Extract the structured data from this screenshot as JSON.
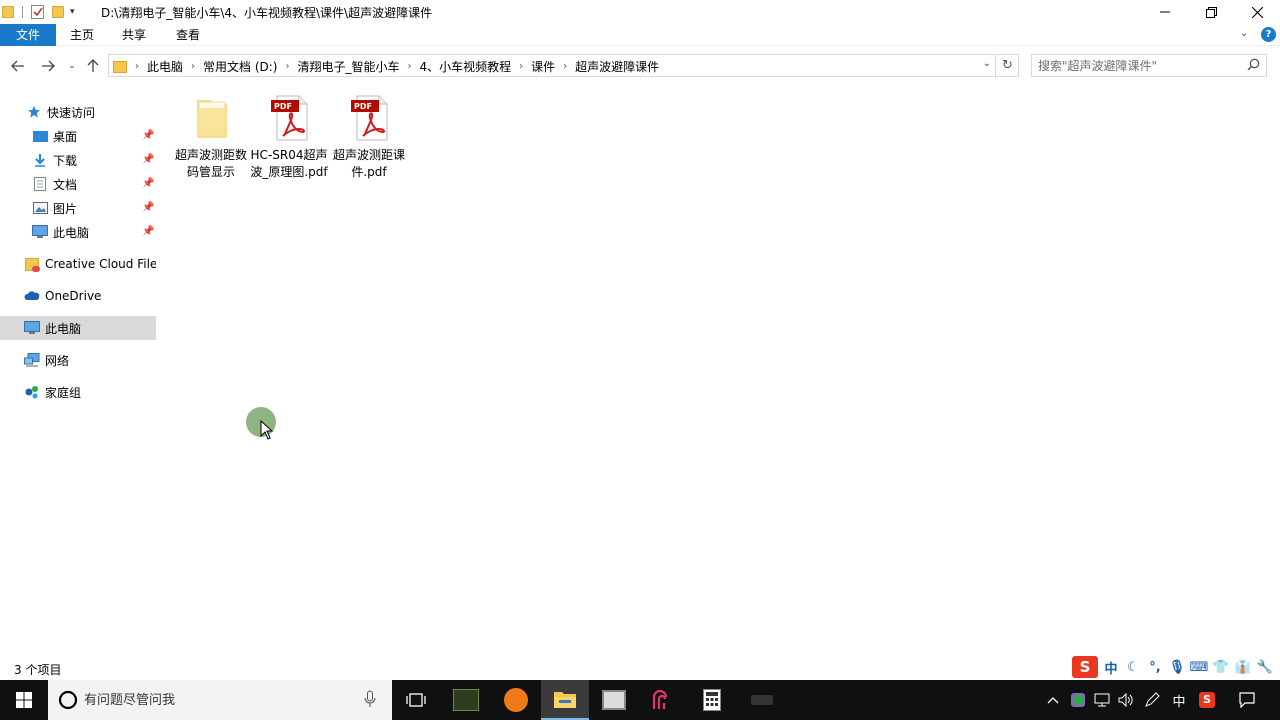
{
  "window": {
    "title": "D:\\清翔电子_智能小车\\4、小车视频教程\\课件\\超声波避障课件"
  },
  "ribbon": {
    "tabs": [
      {
        "label": "文件"
      },
      {
        "label": "主页"
      },
      {
        "label": "共享"
      },
      {
        "label": "查看"
      }
    ]
  },
  "address": {
    "crumbs": [
      "此电脑",
      "常用文档 (D:)",
      "清翔电子_智能小车",
      "4、小车视频教程",
      "课件",
      "超声波避障课件"
    ]
  },
  "search": {
    "placeholder": "搜索\"超声波避障课件\""
  },
  "sidebar": {
    "items": [
      {
        "label": "快速访问",
        "icon": "star-icon"
      },
      {
        "label": "桌面",
        "icon": "desktop-icon",
        "pinned": true
      },
      {
        "label": "下载",
        "icon": "download-icon",
        "pinned": true
      },
      {
        "label": "文档",
        "icon": "document-icon",
        "pinned": true
      },
      {
        "label": "图片",
        "icon": "picture-icon",
        "pinned": true
      },
      {
        "label": "此电脑",
        "icon": "computer-icon",
        "pinned": true
      },
      {
        "label": "Creative Cloud Files",
        "icon": "creative-cloud-icon"
      },
      {
        "label": "OneDrive",
        "icon": "onedrive-icon"
      },
      {
        "label": "此电脑",
        "icon": "computer-icon",
        "selected": true
      },
      {
        "label": "网络",
        "icon": "network-icon"
      },
      {
        "label": "家庭组",
        "icon": "homegroup-icon"
      }
    ]
  },
  "files": [
    {
      "name": "超声波测距数码管显示",
      "type": "folder"
    },
    {
      "name": "HC-SR04超声波_原理图.pdf",
      "type": "pdf"
    },
    {
      "name": "超声波测距课件.pdf",
      "type": "pdf"
    }
  ],
  "status": {
    "item_count": "3 个项目"
  },
  "taskbar": {
    "search_placeholder": "有问题尽管问我",
    "ime_lang": "中"
  },
  "colors": {
    "accent": "#1979ca",
    "taskbar": "#101010",
    "selected": "#d9d9d9"
  }
}
